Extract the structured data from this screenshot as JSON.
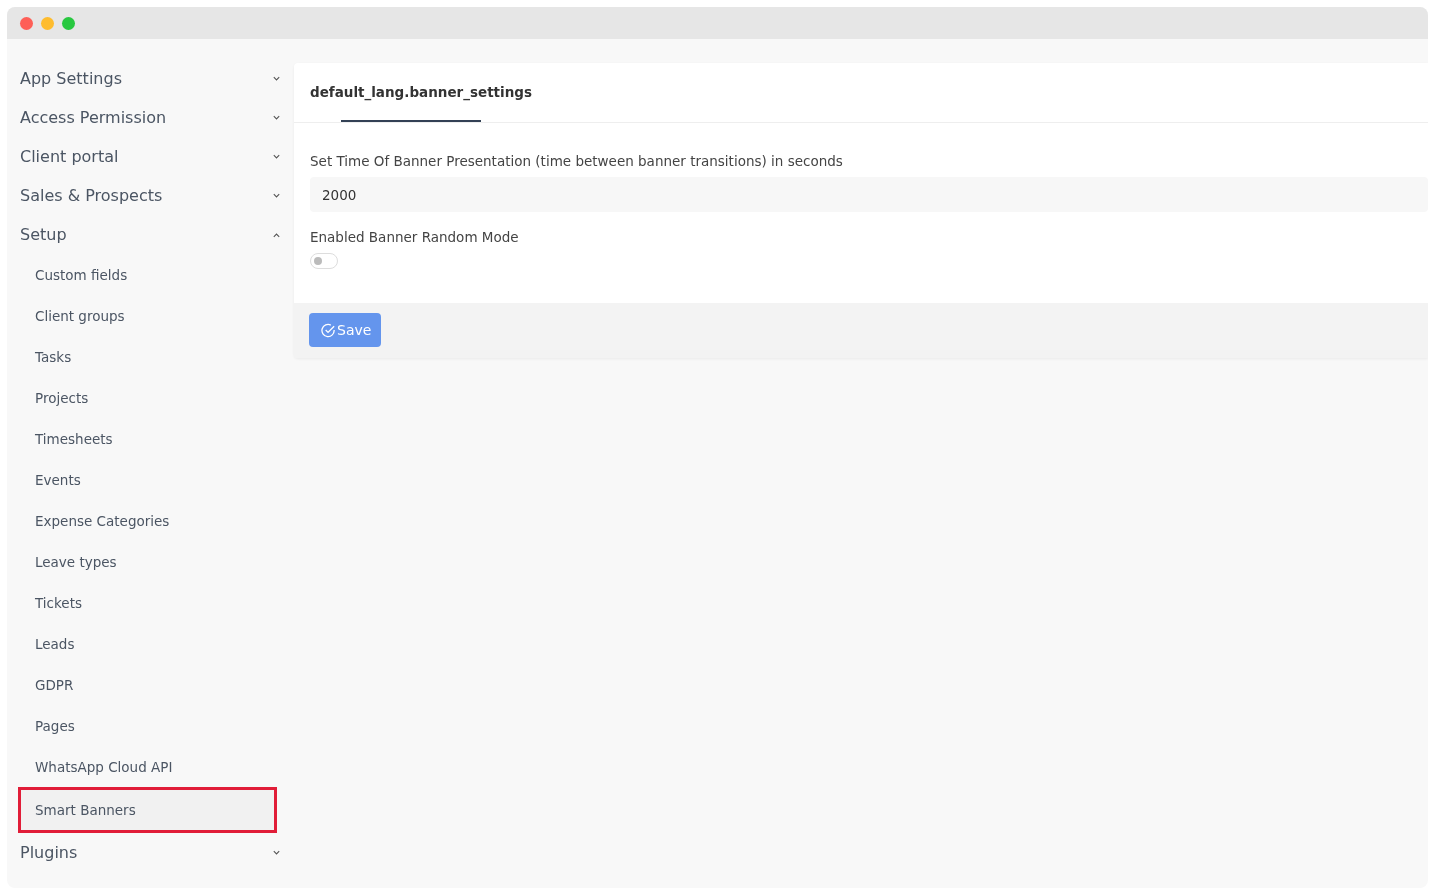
{
  "sidebar": {
    "sections": [
      {
        "label": "App Settings",
        "expanded": false
      },
      {
        "label": "Access Permission",
        "expanded": false
      },
      {
        "label": "Client portal",
        "expanded": false
      },
      {
        "label": "Sales & Prospects",
        "expanded": false
      },
      {
        "label": "Setup",
        "expanded": true,
        "children": [
          {
            "label": "Custom fields",
            "selected": false,
            "highlighted": false
          },
          {
            "label": "Client groups",
            "selected": false,
            "highlighted": false
          },
          {
            "label": "Tasks",
            "selected": false,
            "highlighted": false
          },
          {
            "label": "Projects",
            "selected": false,
            "highlighted": false
          },
          {
            "label": "Timesheets",
            "selected": false,
            "highlighted": false
          },
          {
            "label": "Events",
            "selected": false,
            "highlighted": false
          },
          {
            "label": "Expense Categories",
            "selected": false,
            "highlighted": false
          },
          {
            "label": "Leave types",
            "selected": false,
            "highlighted": false
          },
          {
            "label": "Tickets",
            "selected": false,
            "highlighted": false
          },
          {
            "label": "Leads",
            "selected": false,
            "highlighted": false
          },
          {
            "label": "GDPR",
            "selected": false,
            "highlighted": false
          },
          {
            "label": "Pages",
            "selected": false,
            "highlighted": false
          },
          {
            "label": "WhatsApp Cloud API",
            "selected": false,
            "highlighted": false
          },
          {
            "label": "Smart Banners",
            "selected": true,
            "highlighted": true
          }
        ]
      },
      {
        "label": "Plugins",
        "expanded": false
      }
    ]
  },
  "panel": {
    "tabs": [
      {
        "label": "default_lang.banner_settings",
        "selected": true
      }
    ],
    "fields": [
      {
        "kind": "text",
        "label": "Set Time Of Banner Presentation (time between banner transitions) in seconds",
        "value": "2000"
      },
      {
        "kind": "toggle",
        "label": "Enabled Banner Random Mode",
        "on": false
      }
    ],
    "save_button": "Save"
  }
}
